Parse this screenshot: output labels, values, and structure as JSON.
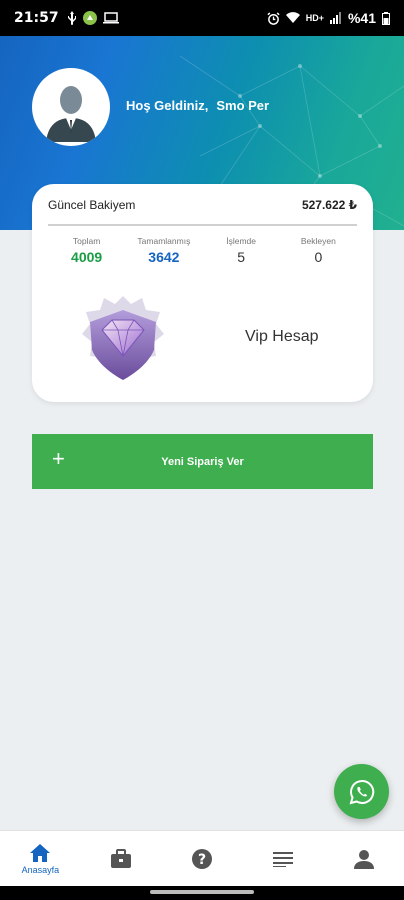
{
  "status_bar": {
    "time": "21:57",
    "network": "HD+",
    "battery": "%41"
  },
  "header": {
    "greeting": "Hoş Geldiniz,",
    "username": "Smo Per"
  },
  "balance_card": {
    "label": "Güncel Bakiyem",
    "value": "527.622 ₺",
    "stats": [
      {
        "label": "Toplam",
        "value": "4009",
        "color": "#1b9d46"
      },
      {
        "label": "Tamamlanmış",
        "value": "3642",
        "color": "#1565c0"
      },
      {
        "label": "İşlemde",
        "value": "5",
        "color": "#333333"
      },
      {
        "label": "Bekleyen",
        "value": "0",
        "color": "#333333"
      }
    ],
    "account_type": "Vip Hesap"
  },
  "new_order_button": {
    "label": "Yeni Sipariş Ver",
    "icon": "plus-icon"
  },
  "whatsapp_button": {
    "icon": "whatsapp-icon"
  },
  "bottom_nav": {
    "items": [
      {
        "label": "Anasayfa",
        "icon": "home-icon",
        "active": true
      },
      {
        "label": "",
        "icon": "briefcase-icon",
        "active": false
      },
      {
        "label": "",
        "icon": "help-icon",
        "active": false
      },
      {
        "label": "",
        "icon": "list-icon",
        "active": false
      },
      {
        "label": "",
        "icon": "person-icon",
        "active": false
      }
    ]
  },
  "colors": {
    "accent_green": "#3fae4f",
    "accent_blue": "#1565c0",
    "background": "#eceff1"
  }
}
